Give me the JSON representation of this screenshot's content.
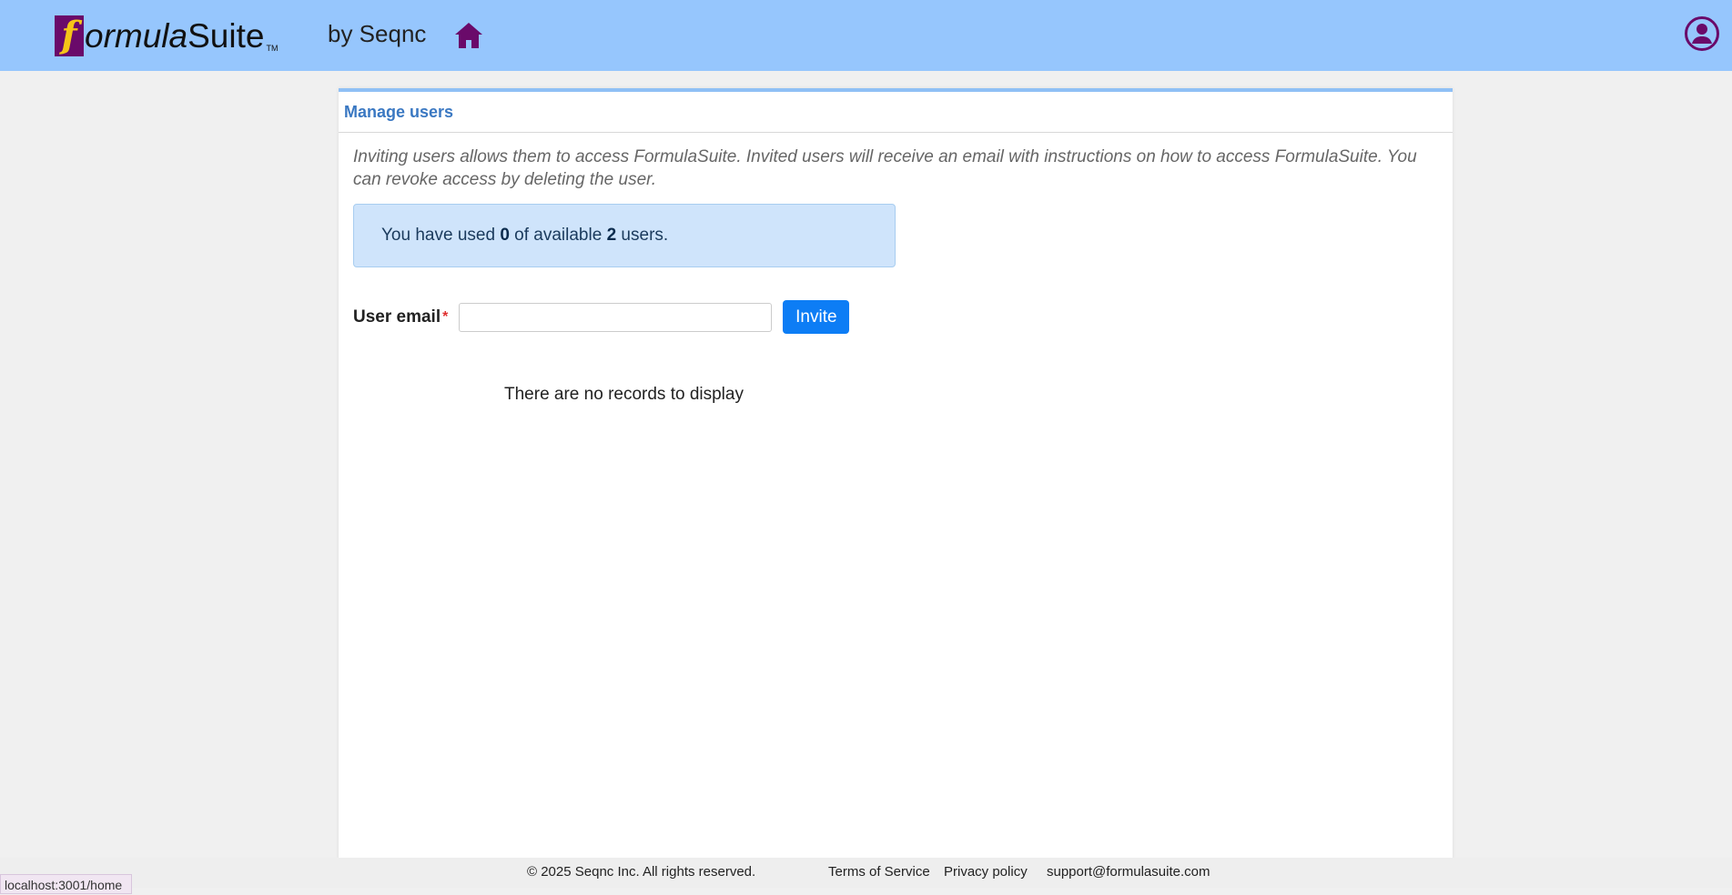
{
  "header": {
    "logo_f": "f",
    "logo_ormula": "ormula",
    "logo_suite": "Suite",
    "logo_tm": "TM",
    "by_label": "by Seqnc",
    "home_icon": "home-icon",
    "user_icon": "user-circle-icon",
    "accent_color": "#96c6fd",
    "brand_purple": "#6a0a6a"
  },
  "panel": {
    "title": "Manage users",
    "intro": "Inviting users allows them to access FormulaSuite. Invited users will receive an email with instructions on how to access FormulaSuite. You can revoke access by deleting the user.",
    "usage": {
      "prefix": "You have used ",
      "used": "0",
      "middle": " of available ",
      "available": "2",
      "suffix": " users."
    },
    "form": {
      "email_label": "User email",
      "required_mark": "*",
      "email_value": "",
      "invite_label": "Invite"
    },
    "empty_message": "There are no records to display"
  },
  "footer": {
    "copyright": "© 2025 Seqnc Inc. All rights reserved.",
    "terms": "Terms of Service",
    "privacy": "Privacy policy",
    "support": "support@formulasuite.com"
  },
  "statusbar": {
    "url": "localhost:3001/home"
  }
}
